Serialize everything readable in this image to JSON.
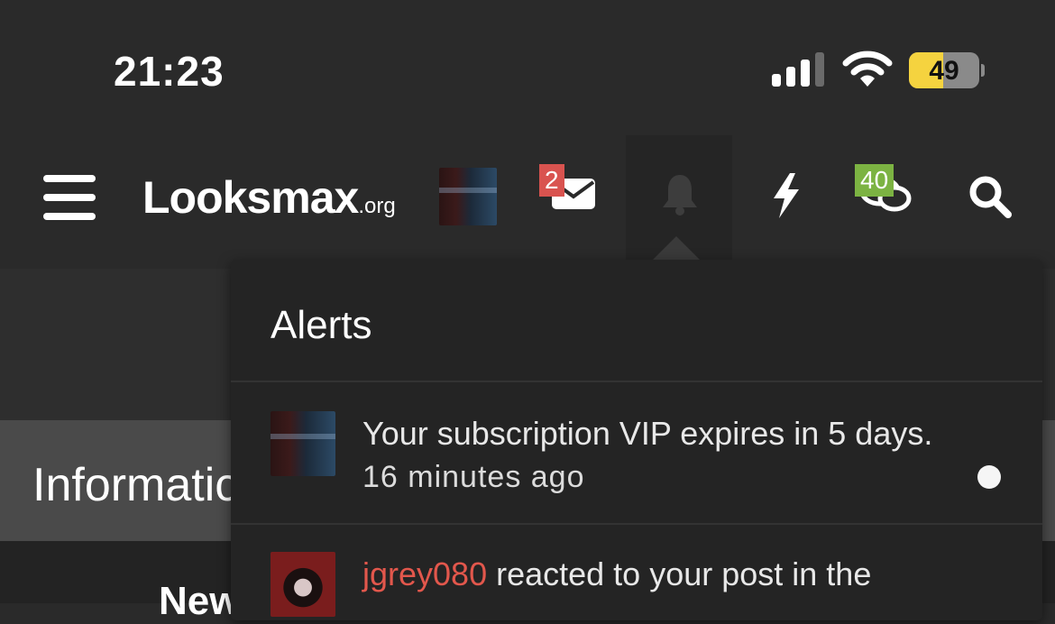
{
  "status_bar": {
    "time": "21:23",
    "battery_percent": "49",
    "battery_level": 0.49
  },
  "nav": {
    "logo_main": "Looksmax",
    "logo_tld": ".org",
    "messages_badge": "2",
    "conversations_badge": "40"
  },
  "background_page": {
    "section_heading": "Informatic",
    "partial_text": "New"
  },
  "alerts": {
    "title": "Alerts",
    "items": [
      {
        "text": "Your subscription VIP expires in 5 days.",
        "time": "16 minutes ago",
        "unread": true
      },
      {
        "user": "jgrey080",
        "text": " reacted to your post in the"
      }
    ]
  },
  "colors": {
    "messages_badge": "#d9534f",
    "conversations_badge": "#7cb342",
    "user_link": "#e2574c",
    "battery_fill": "#f5d33f"
  }
}
